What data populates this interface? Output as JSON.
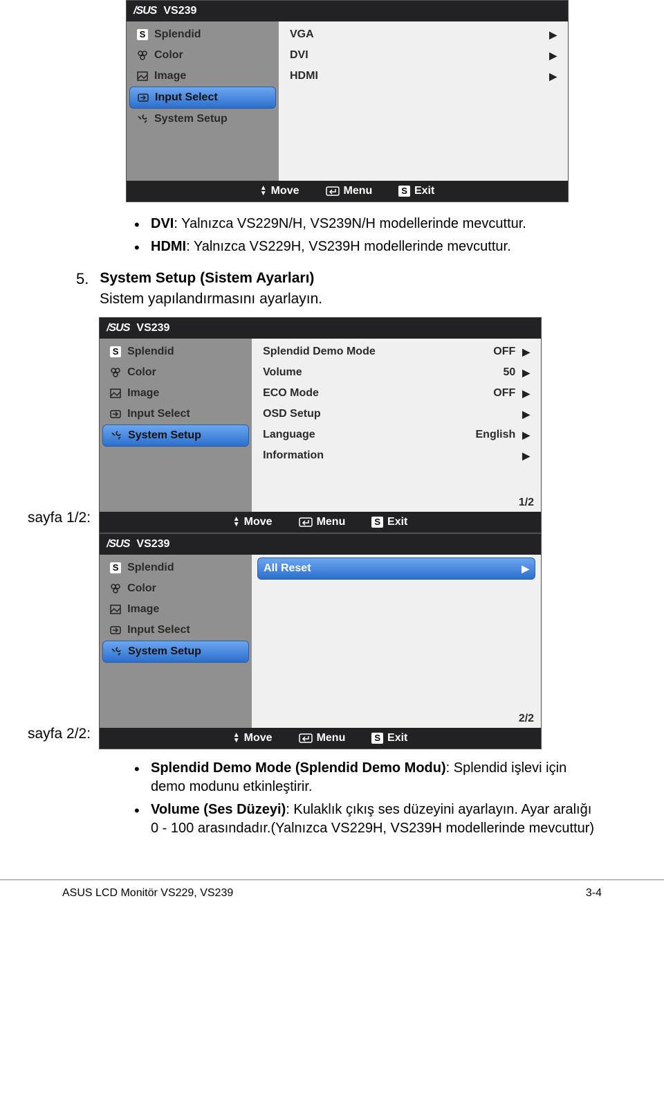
{
  "brand": "/SUS",
  "model": "VS239",
  "icons": {
    "splendid": "S",
    "color": "color-icon",
    "image": "image-icon",
    "input": "input-icon",
    "setup": "setup-icon"
  },
  "panel1": {
    "left": [
      "Splendid",
      "Color",
      "Image",
      "Input Select",
      "System Setup"
    ],
    "selectedLeft": 3,
    "right": [
      {
        "label": "VGA"
      },
      {
        "label": "DVI"
      },
      {
        "label": "HDMI"
      }
    ],
    "footer": {
      "move": "Move",
      "menu": "Menu",
      "exit": "Exit"
    }
  },
  "notes1": [
    {
      "bold": "DVI",
      "rest": ": Yalnızca VS229N/H, VS239N/H modellerinde mevcuttur."
    },
    {
      "bold": "HDMI",
      "rest": ": Yalnızca VS229H, VS239H modellerinde mevcuttur."
    }
  ],
  "section5": {
    "num": "5.",
    "title": "System Setup (Sistem Ayarları)",
    "sub": "Sistem yapılandırmasını ayarlayın."
  },
  "panel2": {
    "left": [
      "Splendid",
      "Color",
      "Image",
      "Input Select",
      "System Setup"
    ],
    "selectedLeft": 4,
    "right": [
      {
        "label": "Splendid Demo Mode",
        "value": "OFF"
      },
      {
        "label": "Volume",
        "value": "50"
      },
      {
        "label": "ECO Mode",
        "value": "OFF"
      },
      {
        "label": "OSD Setup",
        "value": ""
      },
      {
        "label": "Language",
        "value": "English"
      },
      {
        "label": "Information",
        "value": ""
      }
    ],
    "pageIndicator": "1/2",
    "footer": {
      "move": "Move",
      "menu": "Menu",
      "exit": "Exit"
    }
  },
  "sayfa1Label": "sayfa 1/2:",
  "panel3": {
    "left": [
      "Splendid",
      "Color",
      "Image",
      "Input Select",
      "System Setup"
    ],
    "selectedLeft": 4,
    "right": [
      {
        "label": "All Reset",
        "selected": true
      }
    ],
    "pageIndicator": "2/2",
    "footer": {
      "move": "Move",
      "menu": "Menu",
      "exit": "Exit"
    }
  },
  "sayfa2Label": "sayfa 2/2:",
  "notes2": [
    {
      "bold": "Splendid Demo Mode (Splendid Demo Modu)",
      "rest": ": Splendid işlevi için demo modunu etkinleştirir."
    },
    {
      "bold": "Volume (Ses Düzeyi)",
      "rest": ": Kulaklık çıkış ses düzeyini ayarlayın. Ayar aralığı 0 - 100 arasındadır.(Yalnızca VS229H, VS239H modellerinde mevcuttur)"
    }
  ],
  "footer": {
    "left": "ASUS LCD Monitör VS229, VS239",
    "right": "3-4"
  }
}
